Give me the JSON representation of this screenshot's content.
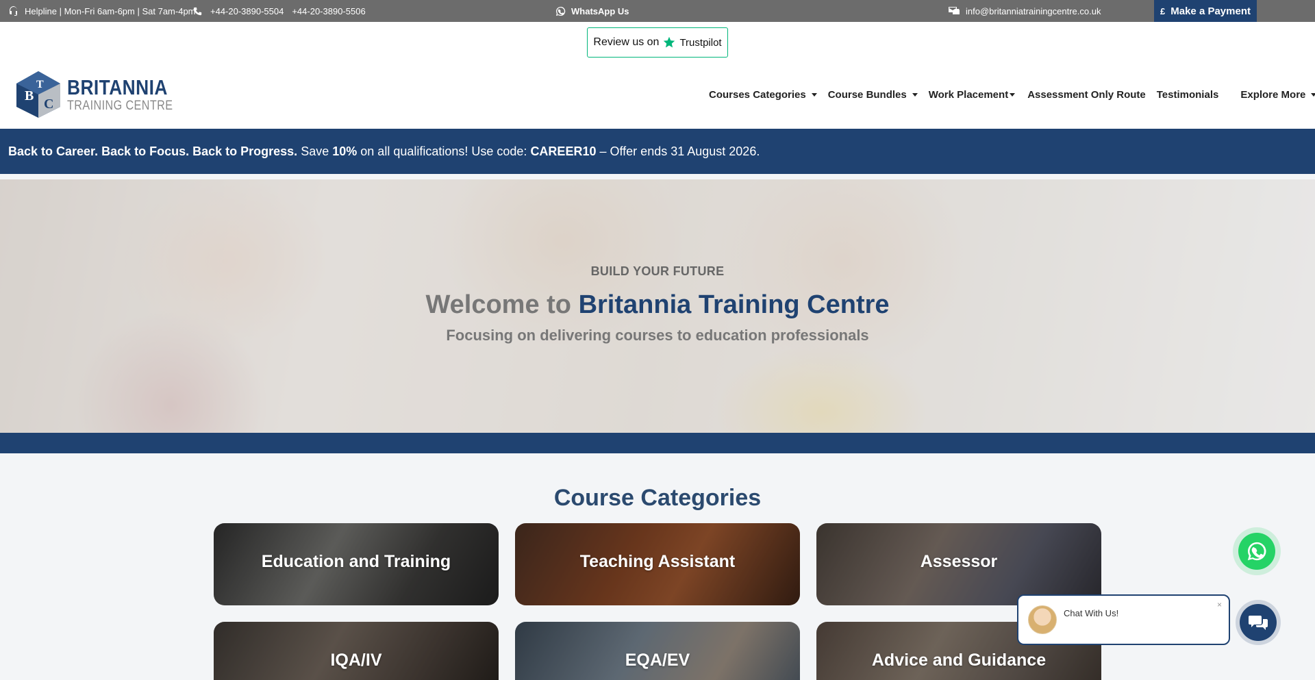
{
  "topbar": {
    "helpline": "Helpline | Mon-Fri 6am-6pm | Sat 7am-4pm",
    "phone1": "+44-20-3890-5504",
    "phone2": "+44-20-3890-5506",
    "whatsapp": "WhatsApp Us",
    "email": "info@britanniatrainingcentre.co.uk",
    "payment": "Make a Payment",
    "payment_symbol": "£"
  },
  "header": {
    "trustpilot_prefix": "Review us on",
    "trustpilot_brand": "Trustpilot",
    "logo_main": "BRITANNIA",
    "logo_sub": "TRAINING CENTRE",
    "logo_letters": [
      "B",
      "T",
      "C"
    ]
  },
  "nav": [
    {
      "label": "Courses Categories"
    },
    {
      "label": "Course Bundles"
    },
    {
      "label": "Work Placement"
    },
    {
      "label": "Assessment Only Route"
    },
    {
      "label": "Testimonials"
    },
    {
      "label": "Explore More"
    }
  ],
  "promo": {
    "headline": "Back to Career. Back to Focus. Back to Progress.",
    "save": "Save",
    "percent": "10%",
    "middle": "on all qualifications! Use code:",
    "code": "CAREER10",
    "end": "– Offer ends 31 August 2026."
  },
  "hero": {
    "eyebrow": "BUILD YOUR FUTURE",
    "title_prefix": "Welcome to",
    "title_accent": "Britannia Training Centre",
    "subtitle": "Focusing on delivering courses to education professionals"
  },
  "categories": {
    "title": "Course Categories",
    "items": [
      {
        "label": "Education and Training"
      },
      {
        "label": "Teaching Assistant"
      },
      {
        "label": "Assessor"
      },
      {
        "label": "IQA/IV"
      },
      {
        "label": "EQA/EV"
      },
      {
        "label": "Advice and Guidance"
      }
    ]
  },
  "chat": {
    "text": "Chat With Us!",
    "close": "×"
  },
  "colors": {
    "brand": "#1f4271",
    "topbar": "#6c6c6c",
    "whatsapp": "#25d366",
    "trustpilot": "#00b67a"
  }
}
